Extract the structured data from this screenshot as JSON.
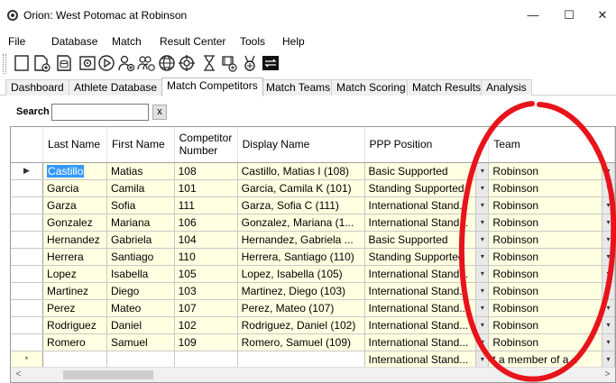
{
  "window": {
    "title": "Orion: West Potomac at Robinson",
    "minimize": "—",
    "maximize": "☐",
    "close": "✕"
  },
  "menu": [
    "File",
    "Database",
    "Match",
    "Result Center",
    "Tools",
    "Help"
  ],
  "toolbar": {
    "icons": [
      "new-match-icon",
      "open-match-icon",
      "database-icon",
      "camera-icon",
      "play-icon",
      "add-athlete-icon",
      "add-team-icon",
      "globe-icon",
      "target-icon",
      "hourglass-icon",
      "add-event-icon",
      "trophy-icon",
      "transfer-icon"
    ]
  },
  "tabs": [
    {
      "label": "Dashboard",
      "active": false
    },
    {
      "label": "Athlete Database",
      "active": false
    },
    {
      "label": "Match Competitors",
      "active": true
    },
    {
      "label": "Match Teams",
      "active": false
    },
    {
      "label": "Match Scoring",
      "active": false
    },
    {
      "label": "Match Results",
      "active": false
    },
    {
      "label": "Analysis",
      "active": false
    }
  ],
  "search": {
    "label": "Search",
    "value": "",
    "clear_label": "x"
  },
  "grid": {
    "columns": [
      "Last Name",
      "First Name",
      "Competitor Number",
      "Display Name",
      "PPP Position",
      "Team"
    ],
    "current_row_marker": "▶",
    "new_row_marker": "*",
    "dropdown_glyph": "▾",
    "rows": [
      [
        "Castillo",
        "Matias",
        "108",
        "Castillo, Matias I (108)",
        "Basic Supported",
        "Robinson"
      ],
      [
        "Garcia",
        "Camila",
        "101",
        "Garcia, Camila K (101)",
        "Standing Supported",
        "Robinson"
      ],
      [
        "Garza",
        "Sofia",
        "111",
        "Garza, Sofia C (111)",
        "International Stand...",
        "Robinson"
      ],
      [
        "Gonzalez",
        "Mariana",
        "106",
        "Gonzalez, Mariana (1...",
        "International Stand...",
        "Robinson"
      ],
      [
        "Hernandez",
        "Gabriela",
        "104",
        "Hernandez, Gabriela ...",
        "Basic Supported",
        "Robinson"
      ],
      [
        "Herrera",
        "Santiago",
        "110",
        "Herrera, Santiago (110)",
        "Standing Supported",
        "Robinson"
      ],
      [
        "Lopez",
        "Isabella",
        "105",
        "Lopez, Isabella (105)",
        "International Stand...",
        "Robinson"
      ],
      [
        "Martinez",
        "Diego",
        "103",
        "Martinez, Diego (103)",
        "International Stand...",
        "Robinson"
      ],
      [
        "Perez",
        "Mateo",
        "107",
        "Perez, Mateo (107)",
        "International Stand...",
        "Robinson"
      ],
      [
        "Rodriguez",
        "Daniel",
        "102",
        "Rodriguez, Daniel (102)",
        "International Stand...",
        "Robinson"
      ],
      [
        "Romero",
        "Samuel",
        "109",
        "Romero, Samuel (109)",
        "International Stand...",
        "Robinson"
      ]
    ],
    "new_row": {
      "ppp_position": "International Stand...",
      "team": "t a member of a..."
    }
  },
  "scrollbar": {
    "left_arrow": "<",
    "right_arrow": ">"
  },
  "colors": {
    "cell_background": "#ffffe1",
    "selection": "#3399ff",
    "annotation_circle": "#e8141b"
  }
}
